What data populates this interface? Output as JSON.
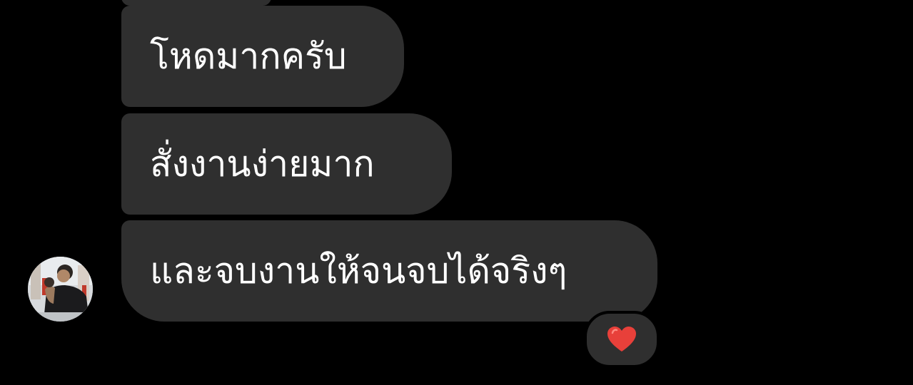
{
  "chat": {
    "messages": [
      {
        "text": "โหดมากครับ"
      },
      {
        "text": "สั่งงานง่ายมาก"
      },
      {
        "text": "และจบงานให้จนจบได้จริงๆ"
      }
    ],
    "reaction": {
      "emoji_icon": "heart-icon",
      "color": "#e8403a"
    },
    "avatar_icon": "profile-photo",
    "bubble_color": "#2f2f2f",
    "background_color": "#000000"
  }
}
